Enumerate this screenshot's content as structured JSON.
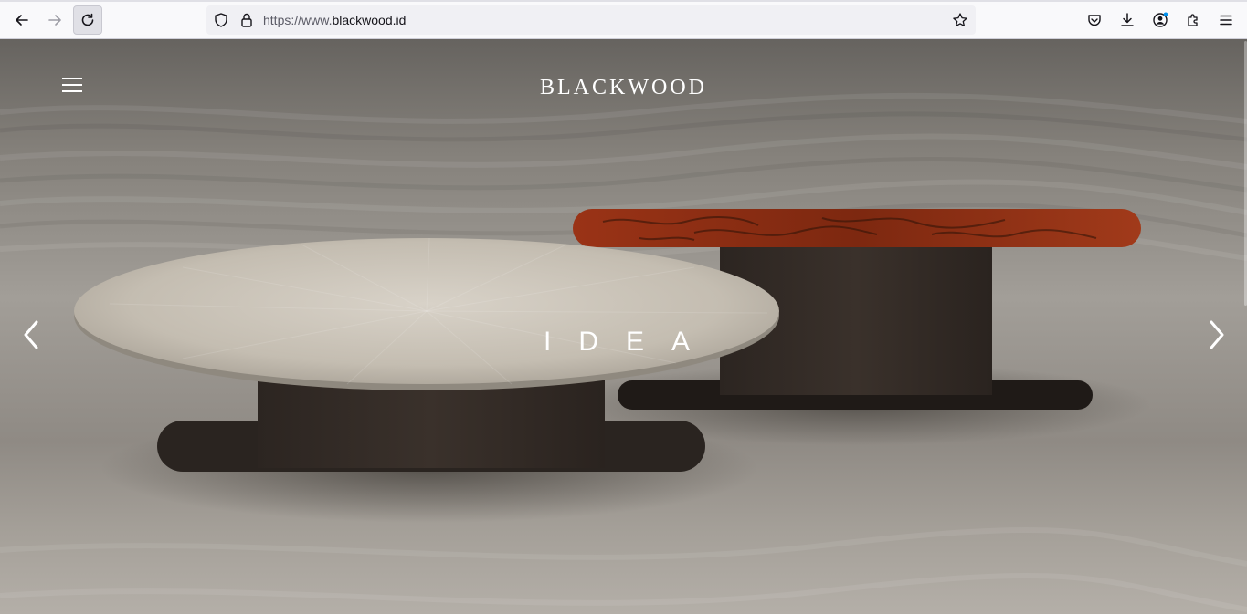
{
  "browser": {
    "url_scheme": "https://www.",
    "url_domain": "blackwood.id",
    "icons": [
      "back-icon",
      "forward-icon",
      "reload-icon",
      "shield-icon",
      "lock-icon",
      "bookmark-star-icon",
      "pocket-icon",
      "download-icon",
      "account-icon",
      "extensions-icon",
      "app-menu-icon"
    ]
  },
  "site": {
    "logo_text": "BLACKWOOD",
    "headline": "IDEA",
    "colors": {
      "overlay_text": "#ffffff",
      "table_top_red": "#8a2e14",
      "table_top_beige": "#c9c2b7",
      "table_base": "#2e2723"
    }
  }
}
